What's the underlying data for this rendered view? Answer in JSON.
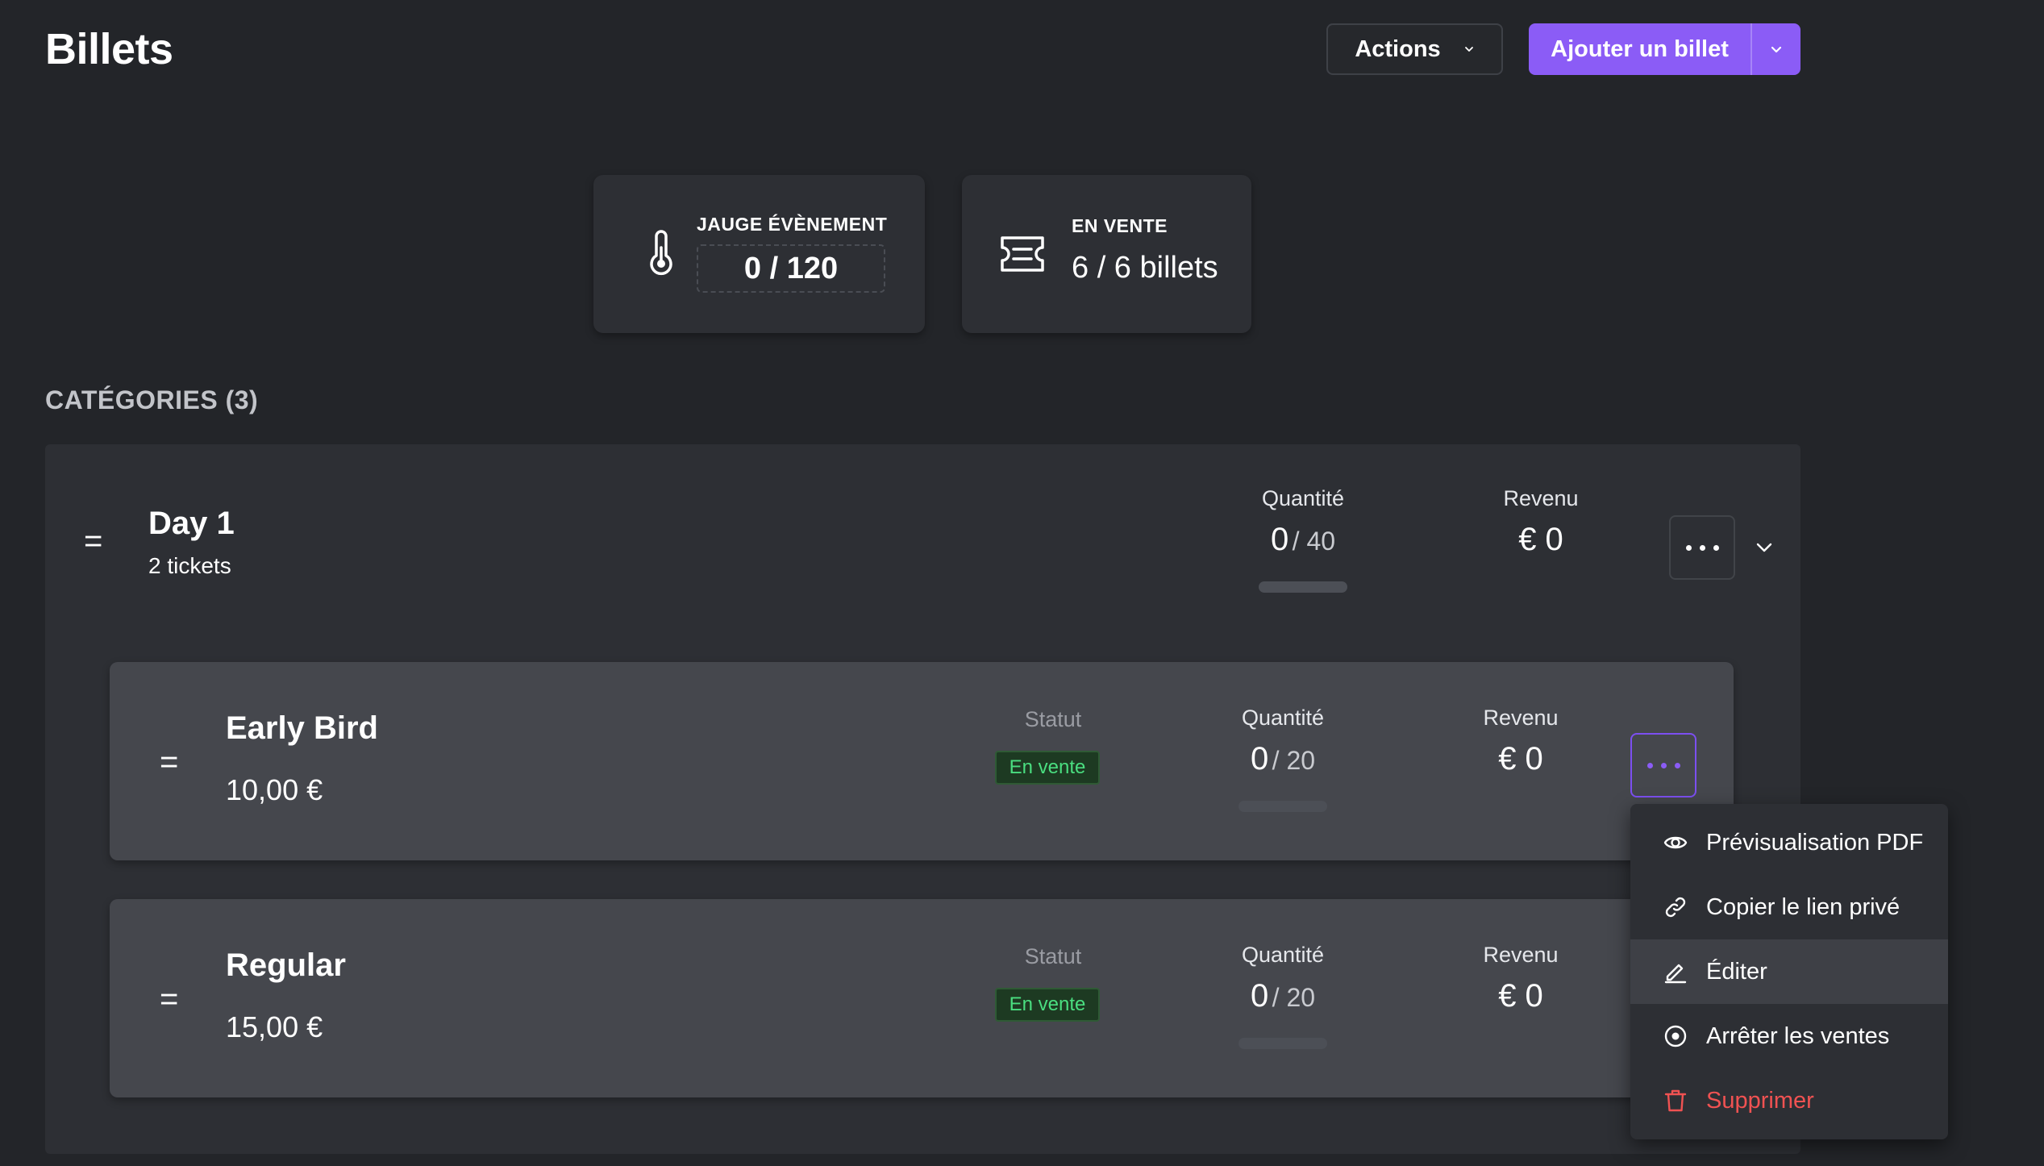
{
  "header": {
    "title": "Billets",
    "actions_label": "Actions",
    "add_label": "Ajouter un billet"
  },
  "stats": {
    "gauge": {
      "label": "JAUGE ÉVÈNEMENT",
      "value": "0 / 120",
      "icon": "thermometer-icon"
    },
    "on_sale": {
      "label": "EN VENTE",
      "value": "6 / 6 billets",
      "icon": "ticket-icon"
    }
  },
  "categories_title": "CATÉGORIES (3)",
  "category": {
    "name": "Day 1",
    "subtitle": "2 tickets",
    "quantity_label": "Quantité",
    "quantity_sold": "0",
    "quantity_total": "/ 40",
    "quantity_progress": 0,
    "revenue_label": "Revenu",
    "revenue": "€ 0"
  },
  "tickets": [
    {
      "name": "Early Bird",
      "price": "10,00 €",
      "status_label": "Statut",
      "status": "En vente",
      "quantity_label": "Quantité",
      "quantity_sold": "0",
      "quantity_total": "/ 20",
      "quantity_progress": 0,
      "revenue_label": "Revenu",
      "revenue": "€ 0"
    },
    {
      "name": "Regular",
      "price": "15,00 €",
      "status_label": "Statut",
      "status": "En vente",
      "quantity_label": "Quantité",
      "quantity_sold": "0",
      "quantity_total": "/ 20",
      "quantity_progress": 0,
      "revenue_label": "Revenu",
      "revenue": "€ 0"
    }
  ],
  "menu": {
    "items": [
      {
        "label": "Prévisualisation PDF",
        "icon": "eye-icon"
      },
      {
        "label": "Copier le lien privé",
        "icon": "link-icon"
      },
      {
        "label": "Éditer",
        "icon": "pencil-icon"
      },
      {
        "label": "Arrêter les ventes",
        "icon": "stop-circle-icon"
      },
      {
        "label": "Supprimer",
        "icon": "trash-icon"
      }
    ]
  },
  "colors": {
    "background": "#232529",
    "panel": "#2d2f34",
    "ticket": "#45474d",
    "accent": "#8b5cf6",
    "status_green": "#4ade80",
    "danger": "#f05252"
  }
}
